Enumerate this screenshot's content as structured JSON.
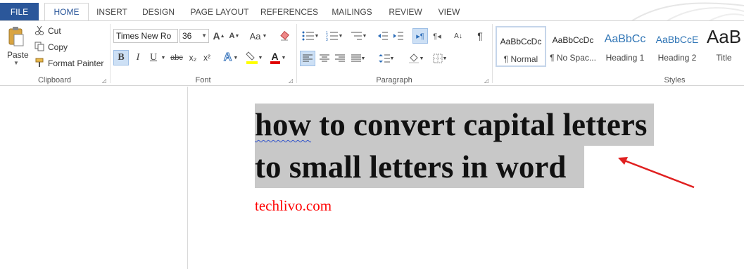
{
  "tabs": [
    "FILE",
    "HOME",
    "INSERT",
    "DESIGN",
    "PAGE LAYOUT",
    "REFERENCES",
    "MAILINGS",
    "REVIEW",
    "VIEW"
  ],
  "clipboard": {
    "paste_label": "Paste",
    "cut_label": "Cut",
    "copy_label": "Copy",
    "format_painter_label": "Format Painter",
    "group_label": "Clipboard"
  },
  "font": {
    "font_name": "Times New Ro",
    "font_size": "36",
    "group_label": "Font",
    "bold": "B",
    "italic": "I",
    "underline": "U",
    "strike": "abc",
    "subscript": "x₂",
    "superscript": "x²",
    "grow": "A",
    "shrink": "A",
    "change_case": "Aa"
  },
  "paragraph": {
    "group_label": "Paragraph"
  },
  "styles": {
    "group_label": "Styles",
    "items": [
      {
        "sample": "AaBbCcDc",
        "name": "¶ Normal"
      },
      {
        "sample": "AaBbCcDc",
        "name": "¶ No Spac..."
      },
      {
        "sample": "AaBbCc",
        "name": "Heading 1"
      },
      {
        "sample": "AaBbCcE",
        "name": "Heading 2"
      },
      {
        "sample": "AaB",
        "name": "Title"
      }
    ]
  },
  "document": {
    "line1_word1": "how",
    "line1_rest": " to convert capital letters",
    "line2": "to small letters in word",
    "site": "techlivo.com"
  },
  "colors": {
    "file_tab": "#2b579a",
    "accent": "#2b579a",
    "selection": "#c8c8c8",
    "site_text": "#ff0000",
    "arrow": "#e02020"
  }
}
